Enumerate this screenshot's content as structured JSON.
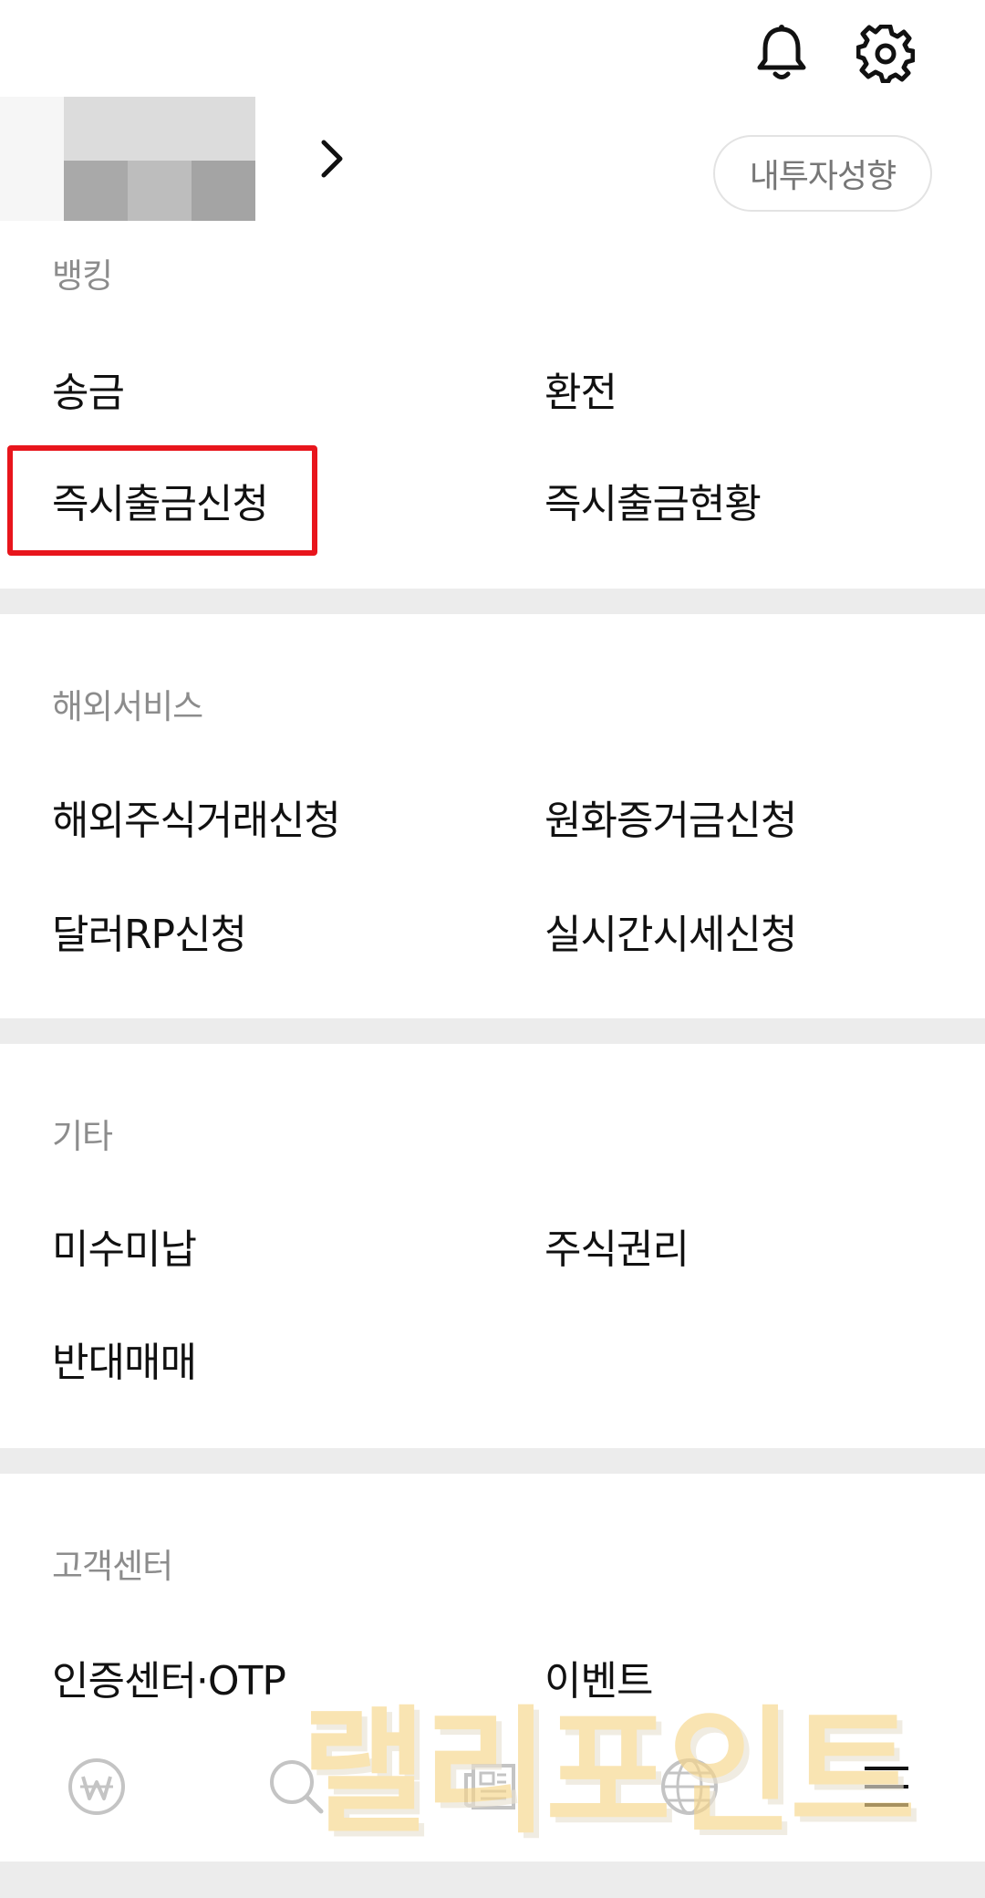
{
  "header": {
    "icons": [
      "bell-icon",
      "gear-icon"
    ],
    "investment_profile_label": "내투자성향"
  },
  "sections": {
    "banking": {
      "label": "뱅킹",
      "items": [
        "송금",
        "환전",
        "즉시출금신청",
        "즉시출금현황"
      ]
    },
    "overseas": {
      "label": "해외서비스",
      "items": [
        "해외주식거래신청",
        "원화증거금신청",
        "달러RP신청",
        "실시간시세신청"
      ]
    },
    "etc": {
      "label": "기타",
      "items": [
        "미수미납",
        "주식권리",
        "반대매매"
      ]
    },
    "support": {
      "label": "고객센터",
      "items": [
        "인증센터·OTP",
        "이벤트"
      ]
    }
  },
  "highlight": {
    "target": "즉시출금신청",
    "color": "#e8151c"
  },
  "bottom_nav": {
    "icons": [
      "won-icon",
      "search-icon",
      "news-icon",
      "globe-icon",
      "menu-icon"
    ]
  },
  "watermark": {
    "text": "랠리포인트"
  },
  "colors": {
    "divider": "#ececec",
    "section_label": "#8c8c8c",
    "text": "#111111"
  }
}
